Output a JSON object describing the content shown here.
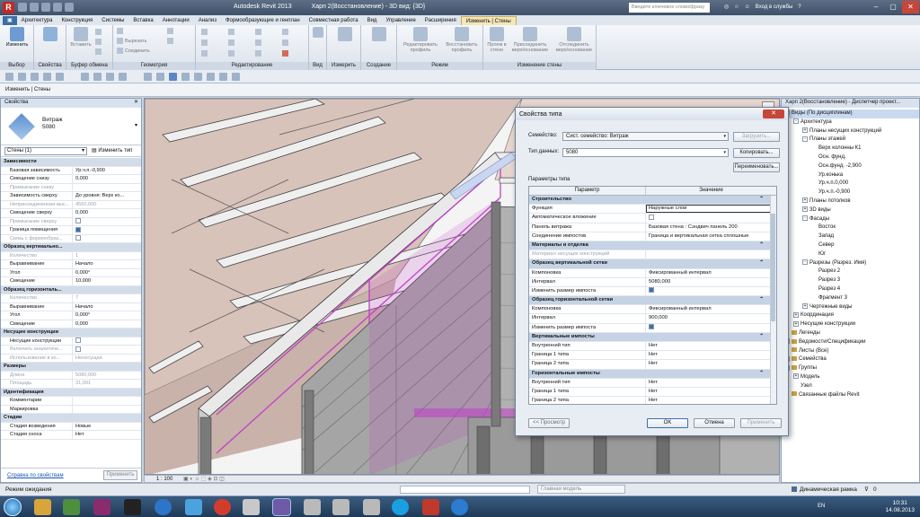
{
  "titlebar": {
    "app_name": "Autodesk Revit 2013",
    "document": "Харп 2(Восстановление) - 3D вид: {3D}",
    "search_placeholder": "Введите ключевое слово/фразу",
    "signin": "Вход в службы",
    "help": "?"
  },
  "tabs": [
    {
      "label": "▣"
    },
    {
      "label": "Архитектура"
    },
    {
      "label": "Конструкция"
    },
    {
      "label": "Системы"
    },
    {
      "label": "Вставка"
    },
    {
      "label": "Аннотации"
    },
    {
      "label": "Анализ"
    },
    {
      "label": "Формообразующие и генплан"
    },
    {
      "label": "Совместная работа"
    },
    {
      "label": "Вид"
    },
    {
      "label": "Управление"
    },
    {
      "label": "Расширения"
    },
    {
      "label": "Изменить | Стены",
      "active": true
    }
  ],
  "ribbon": {
    "groups": [
      "Выбор",
      "Свойства",
      "Буфер обмена",
      "Геометрия",
      "Редактирование",
      "Вид",
      "Измерить",
      "Создание",
      "Режим",
      "Изменение стены"
    ],
    "buttons": {
      "modify": "Изменить",
      "paste": "Вставить",
      "cut": "Вырезать",
      "join": "Соединить",
      "edit_profile": "Редактировать профиль",
      "reset_profile": "Восстановить профиль",
      "openings": "Проем в стене",
      "attach": "Присоединить верх/основание",
      "detach": "Отсоединить верх/основание"
    }
  },
  "mode_bar": {
    "label": "Изменить | Стены"
  },
  "properties": {
    "header": "Свойства",
    "family": "Витраж",
    "type": "5080",
    "filter": "Стены (1)",
    "edit_type": "Изменить тип",
    "help_link": "Справка по свойствам",
    "apply": "Применить",
    "rows": [
      {
        "section": "Зависимости"
      },
      {
        "k": "Базовая зависимость",
        "v": "Ур.ч.п.-0,900"
      },
      {
        "k": "Смещение снизу",
        "v": "0,000"
      },
      {
        "k": "Примыкание снизу",
        "v": "",
        "dis": true
      },
      {
        "k": "Зависимость сверху",
        "v": "До уровня: Верх ко..."
      },
      {
        "k": "Неприсоединенная выс...",
        "v": "4560,000",
        "dis": true
      },
      {
        "k": "Смещение сверху",
        "v": "0,000"
      },
      {
        "k": "Примыкание сверху",
        "v": "",
        "dis": true,
        "cb": false
      },
      {
        "k": "Граница помещения",
        "v": "",
        "cb": true
      },
      {
        "k": "Связь с формообраз...",
        "v": "",
        "dis": true,
        "cb": false
      },
      {
        "section": "Образец вертикально..."
      },
      {
        "k": "Количество",
        "v": "1",
        "dis": true
      },
      {
        "k": "Выравнивание",
        "v": "Начало"
      },
      {
        "k": "Угол",
        "v": "0,000°"
      },
      {
        "k": "Смещение",
        "v": "10,000"
      },
      {
        "section": "Образец горизонталь..."
      },
      {
        "k": "Количество",
        "v": "7",
        "dis": true
      },
      {
        "k": "Выравнивание",
        "v": "Начало"
      },
      {
        "k": "Угол",
        "v": "0,000°"
      },
      {
        "k": "Смещение",
        "v": "0,000"
      },
      {
        "section": "Несущие конструкции"
      },
      {
        "k": "Несущие конструкции",
        "v": "",
        "cb": false
      },
      {
        "k": "Включить аналитиче...",
        "v": "",
        "dis": true,
        "cb": false
      },
      {
        "k": "Использование в ко...",
        "v": "Ненесущая",
        "dis": true
      },
      {
        "section": "Размеры"
      },
      {
        "k": "Длина",
        "v": "5080,000",
        "dis": true
      },
      {
        "k": "Площадь",
        "v": "31,091",
        "dis": true
      },
      {
        "section": "Идентификация"
      },
      {
        "k": "Комментарии",
        "v": ""
      },
      {
        "k": "Маркировка",
        "v": ""
      },
      {
        "section": "Стадии"
      },
      {
        "k": "Стадия возведения",
        "v": "Новые"
      },
      {
        "k": "Стадия сноса",
        "v": "Нет"
      }
    ]
  },
  "viewport": {
    "scale": "1 : 100"
  },
  "browser": {
    "header": "Харп 2(Восстановление) - Диспетчер проект...",
    "nodes": [
      {
        "label": "Виды (По дисциплинам)",
        "lvl": 0,
        "tg": "-",
        "sel": true
      },
      {
        "label": "Архитектура",
        "lvl": 1,
        "tg": "-"
      },
      {
        "label": "Планы несущих конструкций",
        "lvl": 2,
        "tg": "+"
      },
      {
        "label": "Планы этажей",
        "lvl": 2,
        "tg": "-"
      },
      {
        "label": "Верх колонны К1",
        "lvl": 3
      },
      {
        "label": "Осн. фунд.",
        "lvl": 3
      },
      {
        "label": "Осн.фунд. -2,900",
        "lvl": 3
      },
      {
        "label": "Ур.конька",
        "lvl": 3
      },
      {
        "label": "Ур.ч.п.0,000",
        "lvl": 3
      },
      {
        "label": "Ур.ч.п.-0,900",
        "lvl": 3
      },
      {
        "label": "Планы потолков",
        "lvl": 2,
        "tg": "+"
      },
      {
        "label": "3D виды",
        "lvl": 2,
        "tg": "+"
      },
      {
        "label": "Фасады",
        "lvl": 2,
        "tg": "-"
      },
      {
        "label": "Восток",
        "lvl": 3
      },
      {
        "label": "Запад",
        "lvl": 3
      },
      {
        "label": "Север",
        "lvl": 3
      },
      {
        "label": "Юг",
        "lvl": 3
      },
      {
        "label": "Разрезы (Разрез. Имя)",
        "lvl": 2,
        "tg": "-"
      },
      {
        "label": "Разрез 2",
        "lvl": 3
      },
      {
        "label": "Разрез 3",
        "lvl": 3
      },
      {
        "label": "Разрез 4",
        "lvl": 3
      },
      {
        "label": "Фрагмент 3",
        "lvl": 3
      },
      {
        "label": "Чертежные виды",
        "lvl": 2,
        "tg": "+"
      },
      {
        "label": "Координация",
        "lvl": 1,
        "tg": "+"
      },
      {
        "label": "Несущие конструкции",
        "lvl": 1,
        "tg": "+"
      },
      {
        "label": "Легенды",
        "lvl": 0,
        "ic": true
      },
      {
        "label": "Ведомости/Спецификации",
        "lvl": 0,
        "tg": "+",
        "ic": true
      },
      {
        "label": "Листы (Все)",
        "lvl": 0,
        "ic": true
      },
      {
        "label": "Семейства",
        "lvl": 0,
        "tg": "+",
        "ic": true
      },
      {
        "label": "Группы",
        "lvl": 0,
        "tg": "+",
        "ic": true
      },
      {
        "label": "Модель",
        "lvl": 1,
        "tg": "+"
      },
      {
        "label": "Узел",
        "lvl": 1
      },
      {
        "label": "Связанные файлы Revit",
        "lvl": 0,
        "ic": true
      }
    ]
  },
  "status": {
    "text": "Режим ожидания",
    "model": "Главная модель",
    "dynamic_frame": "Динамическая рамка",
    "zero": "0"
  },
  "dialog": {
    "title": "Свойства типа",
    "family_label": "Семейство:",
    "family_value": "Сист. семейство: Витраж",
    "load": "Загрузить...",
    "type_label": "Тип данных:",
    "type_value": "5080",
    "duplicate": "Копировать...",
    "rename": "Переименовать...",
    "params_label": "Параметры типа",
    "col_param": "Параметр",
    "col_value": "Значение",
    "rows": [
      {
        "section": "Строительство"
      },
      {
        "k": "Функция",
        "v": "Наружные слои",
        "hl": true
      },
      {
        "k": "Автоматическое вложение",
        "v": "",
        "cb": false
      },
      {
        "k": "Панель витража",
        "v": "Базовая стена : Сэндвич панель 200"
      },
      {
        "k": "Соединение импостов",
        "v": "Граница и вертикальная сетка сплошные"
      },
      {
        "section": "Материалы и отделка"
      },
      {
        "k": "Материал несущих конструкций",
        "v": "",
        "dis": true
      },
      {
        "section": "Образец вертикальной сетки"
      },
      {
        "k": "Компоновка",
        "v": "Фиксированный интервал"
      },
      {
        "k": "Интервал",
        "v": "5080,000"
      },
      {
        "k": "Изменить размер импоста",
        "v": "",
        "cb": true
      },
      {
        "section": "Образец горизонтальной сетки"
      },
      {
        "k": "Компоновка",
        "v": "Фиксированный интервал"
      },
      {
        "k": "Интервал",
        "v": "900,000"
      },
      {
        "k": "Изменить размер импоста",
        "v": "",
        "cb": true
      },
      {
        "section": "Вертикальные импосты"
      },
      {
        "k": "Внутренний тип",
        "v": "Нет"
      },
      {
        "k": "Граница 1 типа",
        "v": "Нет"
      },
      {
        "k": "Граница 2 типа",
        "v": "Нет"
      },
      {
        "section": "Горизонтальные импосты"
      },
      {
        "k": "Внутренний тип",
        "v": "Нет"
      },
      {
        "k": "Граница 1 типа",
        "v": "Нет"
      },
      {
        "k": "Граница 2 типа",
        "v": "Нет"
      }
    ],
    "preview": "<< Просмотр",
    "ok": "OK",
    "cancel": "Отмена",
    "apply": "Применить"
  },
  "taskbar": {
    "lang": "EN",
    "time": "10:31",
    "date": "14.08.2013"
  },
  "colors": {
    "accent": "#3c6fb2",
    "selection_magenta": "#c03cc8",
    "panel_gray": "#a5a5a5",
    "roof_face": "#d8c3bb"
  }
}
